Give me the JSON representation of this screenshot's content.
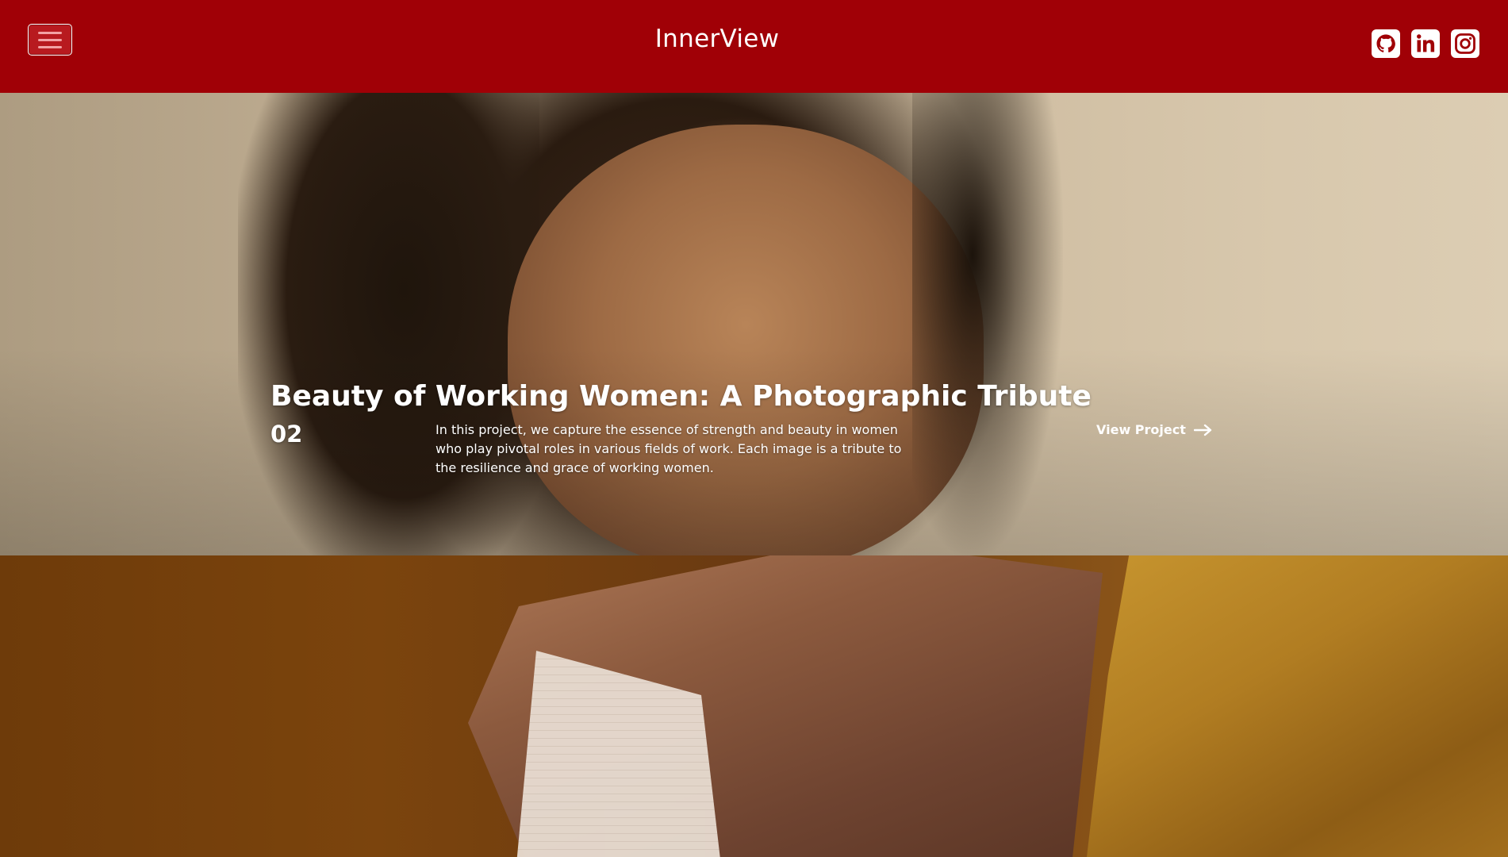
{
  "navbar": {
    "brand": "InnerView",
    "menu_icon": "hamburger-menu-icon",
    "social": [
      {
        "name": "GitHub",
        "icon": "github-icon"
      },
      {
        "name": "LinkedIn",
        "icon": "linkedin-icon"
      },
      {
        "name": "Instagram",
        "icon": "instagram-icon"
      }
    ]
  },
  "hero": {
    "number": "02",
    "title": "Beauty of Working Women: A Photographic Tribute",
    "description": "In this project, we capture the essence of strength and beauty in women who play pivotal roles in various fields of work. Each image is a tribute to the resilience and grace of working women.",
    "cta_label": "View Project",
    "cta_icon": "arrow-right-icon"
  },
  "colors": {
    "navbar_bg": "#a00006",
    "text": "#ffffff"
  }
}
